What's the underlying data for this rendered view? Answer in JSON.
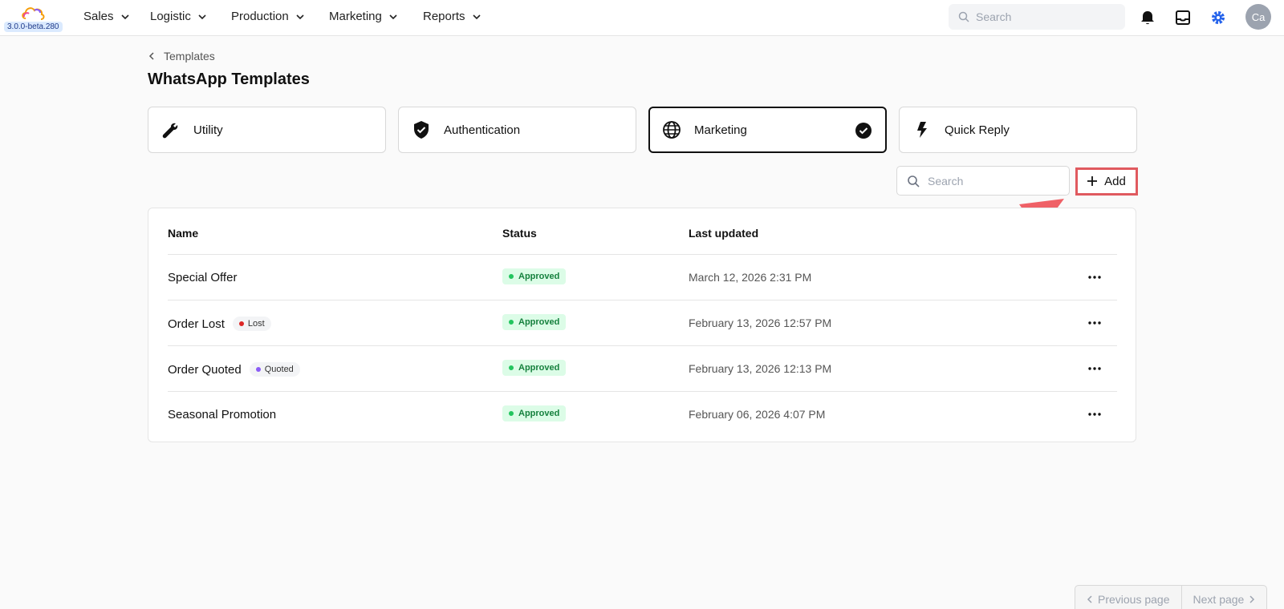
{
  "app": {
    "version": "3.0.0-beta.280"
  },
  "nav": {
    "items": [
      {
        "label": "Sales"
      },
      {
        "label": "Logistic"
      },
      {
        "label": "Production"
      },
      {
        "label": "Marketing"
      },
      {
        "label": "Reports"
      }
    ],
    "search_placeholder": "Search",
    "avatar_initials": "Ca",
    "accent_color": "#2563eb"
  },
  "breadcrumb": {
    "label": "Templates"
  },
  "page": {
    "title": "WhatsApp Templates"
  },
  "categories": [
    {
      "label": "Utility",
      "icon": "wrench-icon",
      "selected": false
    },
    {
      "label": "Authentication",
      "icon": "shield-check-icon",
      "selected": false
    },
    {
      "label": "Marketing",
      "icon": "globe-icon",
      "selected": true
    },
    {
      "label": "Quick Reply",
      "icon": "bolt-icon",
      "selected": false
    }
  ],
  "toolbar": {
    "search_placeholder": "Search",
    "add_label": "Add",
    "highlight_color": "#e05a5f"
  },
  "table": {
    "columns": [
      "Name",
      "Status",
      "Last updated"
    ],
    "rows": [
      {
        "name": "Special Offer",
        "tag": null,
        "status": "Approved",
        "updated": "March 12, 2026 2:31 PM"
      },
      {
        "name": "Order Lost",
        "tag": {
          "label": "Lost",
          "color": "#dc2626"
        },
        "status": "Approved",
        "updated": "February 13, 2026 12:57 PM"
      },
      {
        "name": "Order Quoted",
        "tag": {
          "label": "Quoted",
          "color": "#8b5cf6"
        },
        "status": "Approved",
        "updated": "February 13, 2026 12:13 PM"
      },
      {
        "name": "Seasonal Promotion",
        "tag": null,
        "status": "Approved",
        "updated": "February 06, 2026 4:07 PM"
      }
    ],
    "status_color": "#22c55e"
  },
  "pagination": {
    "previous_label": "Previous page",
    "next_label": "Next page"
  }
}
